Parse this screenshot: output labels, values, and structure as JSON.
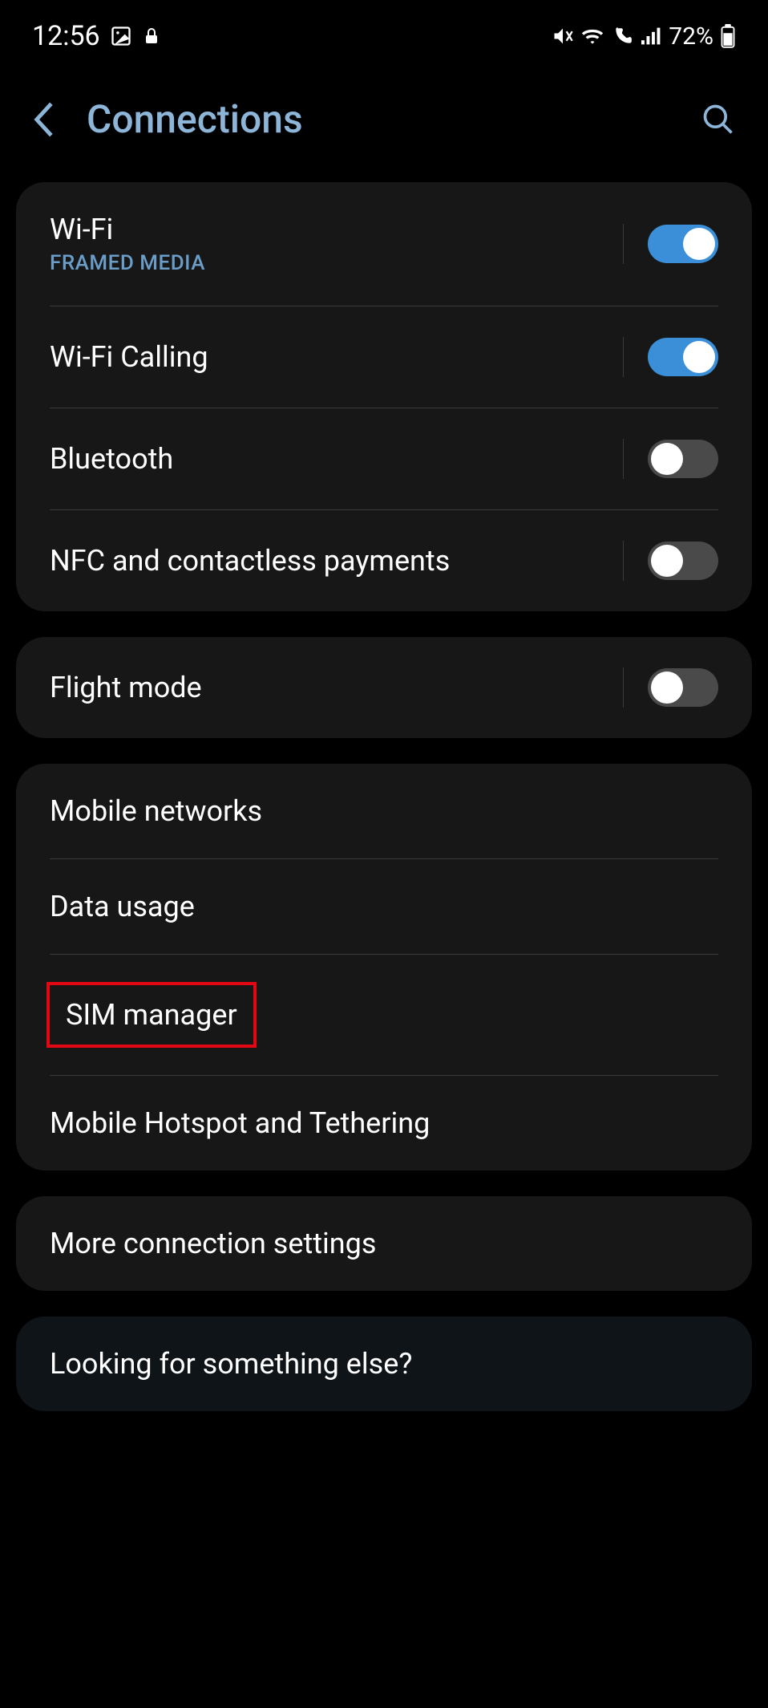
{
  "statusBar": {
    "time": "12:56",
    "battery": "72%"
  },
  "header": {
    "title": "Connections"
  },
  "groups": [
    {
      "rows": [
        {
          "title": "Wi-Fi",
          "subtitle": "FRAMED MEDIA",
          "toggle": "on"
        },
        {
          "title": "Wi-Fi Calling",
          "toggle": "on"
        },
        {
          "title": "Bluetooth",
          "toggle": "off"
        },
        {
          "title": "NFC and contactless payments",
          "toggle": "off"
        }
      ]
    },
    {
      "rows": [
        {
          "title": "Flight mode",
          "toggle": "off"
        }
      ]
    },
    {
      "rows": [
        {
          "title": "Mobile networks"
        },
        {
          "title": "Data usage"
        },
        {
          "title": "SIM manager",
          "highlighted": true
        },
        {
          "title": "Mobile Hotspot and Tethering"
        }
      ]
    },
    {
      "rows": [
        {
          "title": "More connection settings"
        }
      ]
    },
    {
      "darker": true,
      "rows": [
        {
          "title": "Looking for something else?"
        }
      ]
    }
  ]
}
